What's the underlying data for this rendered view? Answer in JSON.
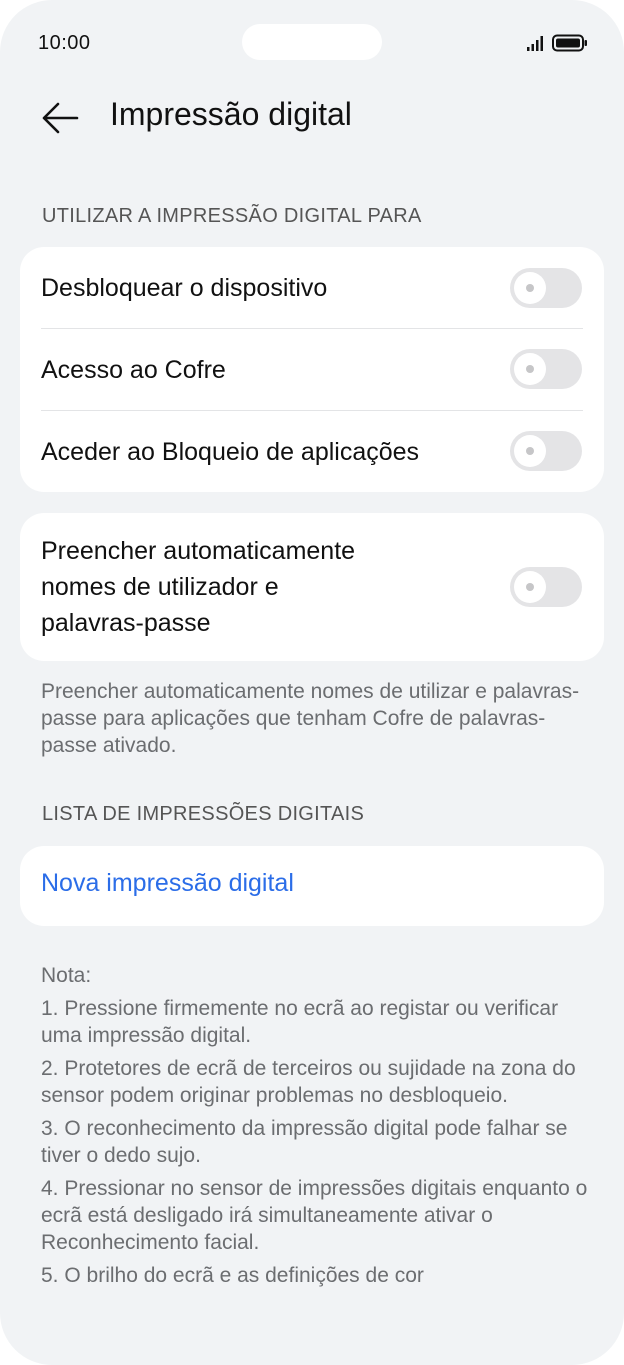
{
  "status_bar": {
    "time": "10:00"
  },
  "header": {
    "title": "Impressão digital"
  },
  "section_use": {
    "label": "UTILIZAR A IMPRESSÃO DIGITAL PARA",
    "items": [
      {
        "label": "Desbloquear o dispositivo",
        "enabled": false
      },
      {
        "label": "Acesso ao Cofre",
        "enabled": false
      },
      {
        "label": "Aceder ao Bloqueio de aplicações",
        "enabled": false
      }
    ]
  },
  "autofill": {
    "label_line1": "Preencher automaticamente",
    "label_line2": "nomes de utilizador e",
    "label_line3": "palavras-passe",
    "enabled": false,
    "description": "Preencher automaticamente nomes de utilizar e palavras-passe para aplicações que tenham Cofre de palavras-passe ativado."
  },
  "section_list": {
    "label": "LISTA DE IMPRESSÕES DIGITAIS",
    "new_button": "Nova impressão digital"
  },
  "notes": {
    "title": "Nota:",
    "items": [
      "1. Pressione firmemente no ecrã ao registar ou verificar uma impressão digital.",
      "2. Protetores de ecrã de terceiros ou sujidade na zona do sensor podem originar problemas no desbloqueio.",
      "3. O reconhecimento da impressão digital pode falhar se tiver o dedo sujo.",
      "4. Pressionar no sensor de impressões digitais enquanto o ecrã está desligado irá simultaneamente ativar o Reconhecimento facial.",
      "5. O brilho do ecrã e as definições de cor"
    ]
  },
  "colors": {
    "background": "#f1f3f5",
    "card": "#ffffff",
    "accent": "#2b6de8",
    "toggle_off": "#e4e4e6"
  }
}
